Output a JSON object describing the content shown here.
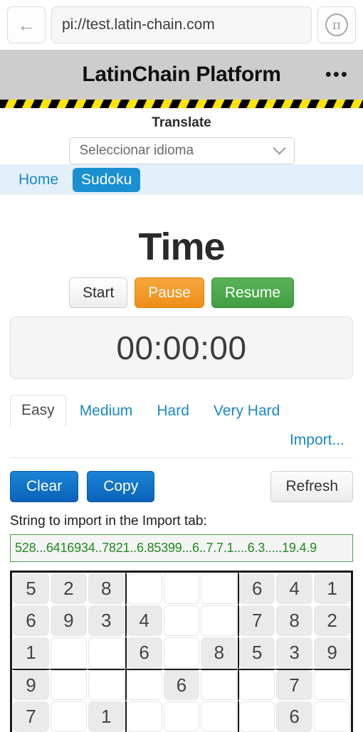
{
  "browser": {
    "back_icon": "arrow-left-icon",
    "url": "pi://test.latin-chain.com",
    "pi_icon": "π"
  },
  "appbar": {
    "title": "LatinChain Platform",
    "menu": "•••"
  },
  "translate": {
    "label": "Translate",
    "selected_option": "Seleccionar idioma",
    "chevron_icon": "chevron-down-icon"
  },
  "site_nav": {
    "items": [
      {
        "label": "Home",
        "active": false
      },
      {
        "label": "Sudoku",
        "active": true
      }
    ],
    "active_color": "#1a8fd1",
    "bg_color": "#e3f0fa"
  },
  "main": {
    "page_title": "Time",
    "timer_buttons": [
      {
        "label": "Start",
        "style": "default",
        "color": "#ededed"
      },
      {
        "label": "Pause",
        "style": "warning",
        "color": "#ef8f18"
      },
      {
        "label": "Resume",
        "style": "success",
        "color": "#419f41"
      }
    ],
    "timer_value": "00:00:00",
    "difficulty_tabs": [
      {
        "label": "Easy",
        "active": true
      },
      {
        "label": "Medium",
        "active": false
      },
      {
        "label": "Hard",
        "active": false
      },
      {
        "label": "Very Hard",
        "active": false
      }
    ],
    "import_link": "Import...",
    "actions": {
      "clear": "Clear",
      "copy": "Copy",
      "refresh": "Refresh"
    },
    "import_caption": "String to import in the Import tab:",
    "import_string": "528...6416934..7821..6.85399...6..7.7.1....6.3.....19.4.9",
    "import_string_color": "#1f8a1f"
  },
  "sudoku": {
    "rows": [
      [
        "5",
        "2",
        "8",
        "",
        "",
        "",
        "6",
        "4",
        "1"
      ],
      [
        "6",
        "9",
        "3",
        "4",
        "",
        "",
        "7",
        "8",
        "2"
      ],
      [
        "1",
        "",
        "",
        "6",
        "",
        "8",
        "5",
        "3",
        "9"
      ],
      [
        "9",
        "",
        "",
        "",
        "6",
        "",
        "",
        "7",
        ""
      ],
      [
        "7",
        "",
        "1",
        "",
        "",
        "",
        "",
        "6",
        ""
      ]
    ]
  }
}
